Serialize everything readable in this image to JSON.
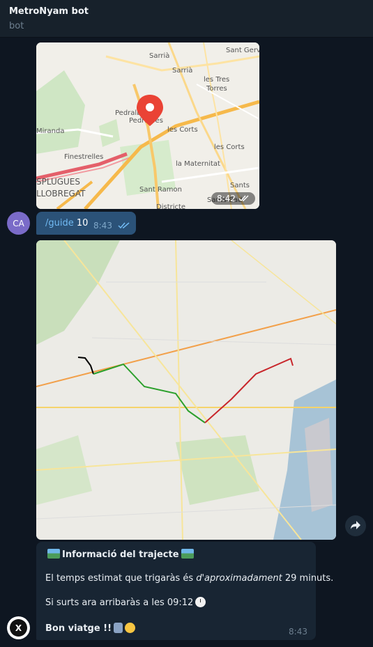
{
  "header": {
    "title": "MetroNyam bot",
    "subtitle": "bot"
  },
  "map_message": {
    "time": "8:42",
    "labels": [
      "Sarrià",
      "Sarrià",
      "Sant Gerv",
      "les Tres",
      "Torres",
      "Pedralbes",
      "Pedralbes",
      "les Corts",
      "Miranda",
      "les Corts",
      "Finestrelles",
      "la Maternitat",
      "SPLUGUES",
      "LLOBREGAT",
      "Sant Ramon",
      "Sants",
      "Sants-Bad",
      "Districte"
    ]
  },
  "outgoing": {
    "avatar_initials": "CA",
    "command": "/guide",
    "argument": "10",
    "time": "8:43"
  },
  "route_message": {
    "colors": {
      "walk": "#000000",
      "green_line": "#2ca02c",
      "red_line": "#c8262b"
    }
  },
  "info_message": {
    "title": "Informació del trajecte",
    "line2_prefix": "El temps estimat que trigaràs és ",
    "line2_emph": "d'aproximadament",
    "line2_suffix": " 29 minuts.",
    "line3": "Si surts ara arribaràs a les 09:12",
    "line4": "Bon viatge !!",
    "time": "8:43"
  },
  "bot_avatar": {
    "text": "X"
  },
  "icons": [
    "map-emoji",
    "clock-emoji",
    "metro-emoji",
    "grin-emoji",
    "double-check-icon",
    "forward-icon",
    "location-pin-icon"
  ]
}
